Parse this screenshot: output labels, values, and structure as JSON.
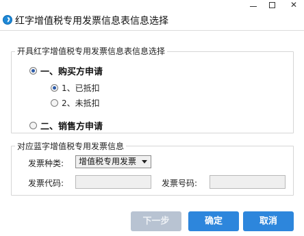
{
  "window": {
    "title": "红字增值税专用发票信息表信息选择",
    "minimize_label": "—",
    "maximize_label": "□",
    "close_label": "✕"
  },
  "issue_group": {
    "legend": "开具红字增值税专用发票信息表信息选择",
    "options": [
      {
        "label": "一、购买方申请",
        "checked": true
      },
      {
        "label": "1、已抵扣",
        "checked": true
      },
      {
        "label": "2、未抵扣",
        "checked": false
      },
      {
        "label": "二、销售方申请",
        "checked": false
      }
    ]
  },
  "blue_invoice_group": {
    "legend": "对应蓝字增值税专用发票信息",
    "invoice_type_label": "发票种类:",
    "invoice_type_value": "增值税专用发票",
    "invoice_code_label": "发票代码:",
    "invoice_code_value": "",
    "invoice_number_label": "发票号码:",
    "invoice_number_value": ""
  },
  "buttons": {
    "prev": "下一步",
    "ok": "确定",
    "cancel": "取消"
  },
  "colors": {
    "accent": "#2d86dc",
    "disabled_button": "#b8c3d2",
    "radio_dot": "#2b5aa8"
  }
}
